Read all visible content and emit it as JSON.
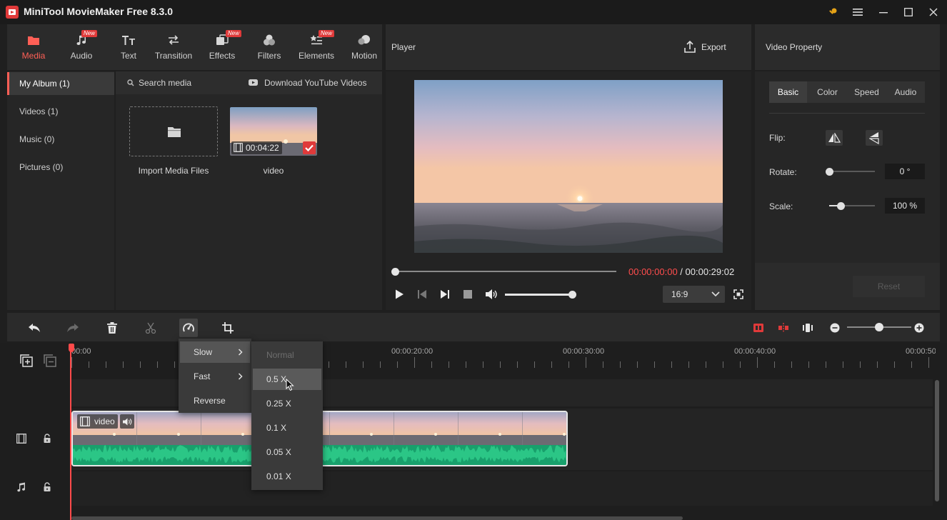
{
  "app": {
    "title": "MiniTool MovieMaker Free 8.3.0"
  },
  "toolbar": {
    "tabs": [
      {
        "label": "Media",
        "icon": "folder-icon",
        "badge": ""
      },
      {
        "label": "Audio",
        "icon": "music-note-icon",
        "badge": "New"
      },
      {
        "label": "Text",
        "icon": "text-icon",
        "badge": ""
      },
      {
        "label": "Transition",
        "icon": "transition-arrows-icon",
        "badge": ""
      },
      {
        "label": "Effects",
        "icon": "effects-icon",
        "badge": "New"
      },
      {
        "label": "Filters",
        "icon": "filters-icon",
        "badge": ""
      },
      {
        "label": "Elements",
        "icon": "elements-icon",
        "badge": "New"
      },
      {
        "label": "Motion",
        "icon": "motion-icon",
        "badge": ""
      }
    ],
    "active_tab": "Media"
  },
  "library": {
    "albums": [
      "My Album (1)",
      "Videos (1)",
      "Music (0)",
      "Pictures (0)"
    ],
    "search_placeholder": "Search media",
    "download_label": "Download YouTube Videos",
    "import_label": "Import Media Files",
    "item": {
      "name": "video",
      "duration": "00:04:22"
    }
  },
  "player": {
    "title": "Player",
    "export_label": "Export",
    "current_time": "00:00:00:00",
    "separator": " / ",
    "total_time": "00:00:29:02",
    "aspect_ratio": "16:9",
    "progress": 0,
    "volume": 1.0
  },
  "property": {
    "title": "Video Property",
    "tabs": [
      "Basic",
      "Color",
      "Speed",
      "Audio"
    ],
    "active_tab": "Basic",
    "flip_label": "Flip:",
    "rotate_label": "Rotate:",
    "rotate_value": "0 °",
    "rotate_slider": 0,
    "scale_label": "Scale:",
    "scale_value": "100 %",
    "scale_slider": 0.25,
    "reset_label": "Reset"
  },
  "timeline": {
    "ruler_labels": [
      "00:00",
      "00:00:20:00",
      "00:00:30:00",
      "00:00:40:00",
      "00:00:50"
    ],
    "clip_label": "video",
    "zoom_level": 0.5
  },
  "speed_menu": {
    "items": [
      {
        "label": "Slow",
        "submenu": true
      },
      {
        "label": "Fast",
        "submenu": true
      },
      {
        "label": "Reverse",
        "submenu": false
      }
    ],
    "submenu": [
      "Normal",
      "0.5 X",
      "0.25 X",
      "0.1 X",
      "0.05 X",
      "0.01 X"
    ]
  },
  "colors": {
    "accent": "#ff5f56",
    "waveform": "#18a06c"
  }
}
